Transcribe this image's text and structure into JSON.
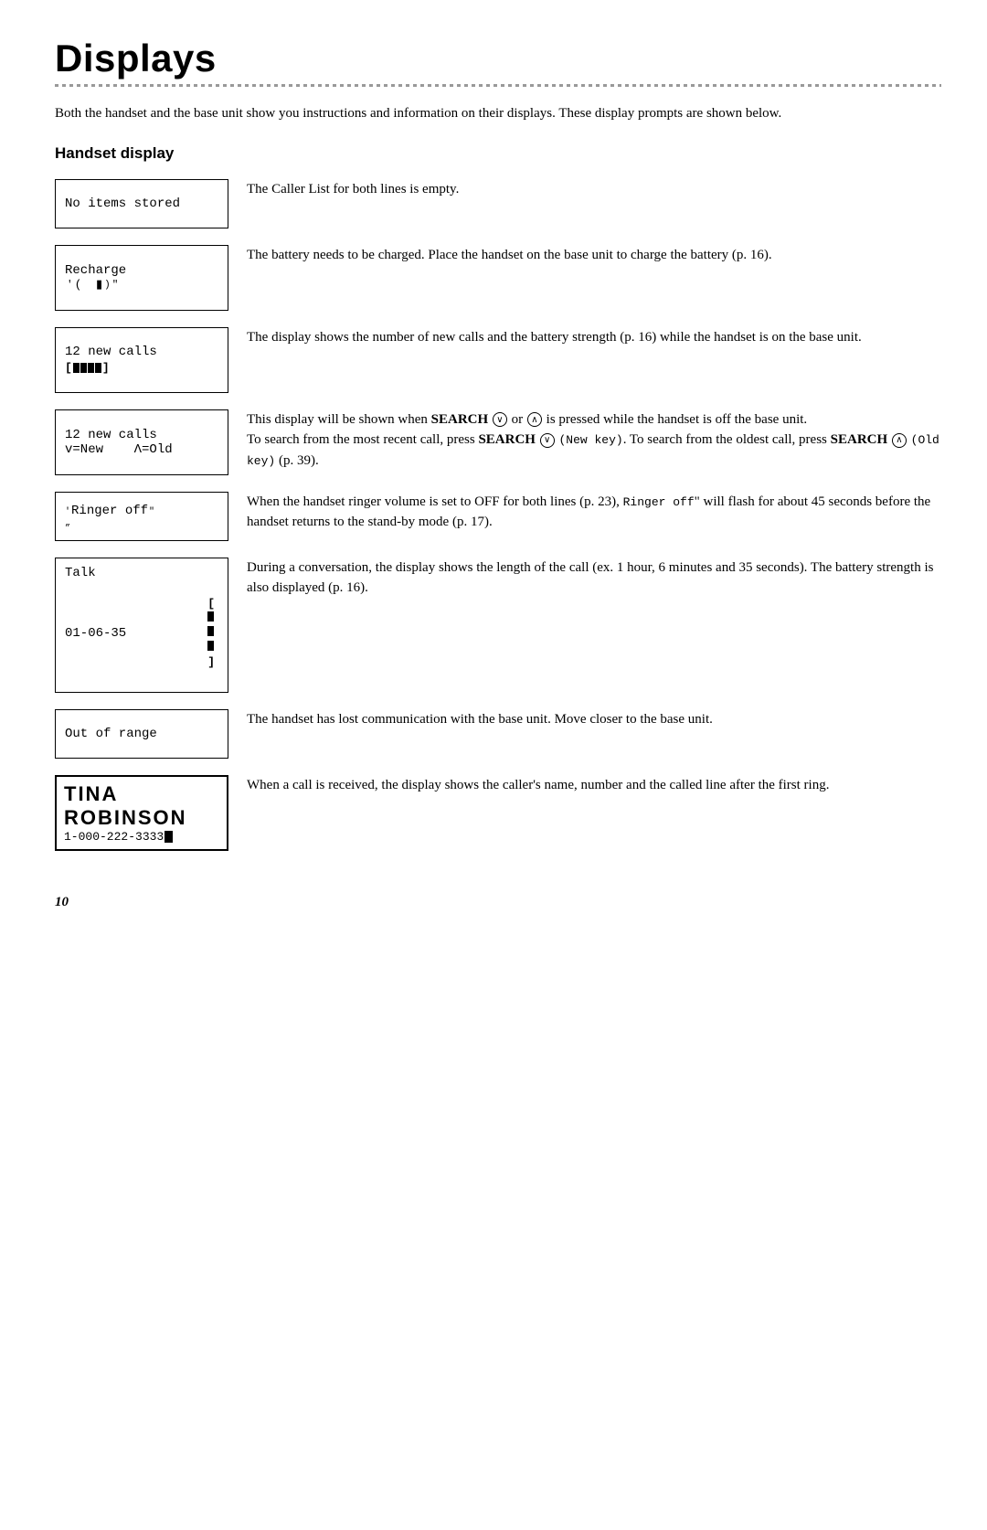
{
  "page": {
    "title": "Displays",
    "intro": "Both the handset and the base unit show you instructions and information on their displays. These display prompts are shown below.",
    "section_title": "Handset display",
    "footer_page": "10"
  },
  "rows": [
    {
      "id": "no-items",
      "display_lines": [
        "No items stored"
      ],
      "description": "The Caller List for both lines is empty."
    },
    {
      "id": "recharge",
      "display_lines": [
        "Recharge",
        "recharge_icon"
      ],
      "description": "The battery needs to be charged. Place the handset on the base unit to charge the battery (p. 16)."
    },
    {
      "id": "new-calls-base",
      "display_lines": [
        "12 new calls",
        "battery_bar"
      ],
      "description": "The display shows the number of new calls and the battery strength (p. 16) while the handset is on the base unit."
    },
    {
      "id": "new-calls-search",
      "display_lines": [
        "12 new calls",
        "v=New   Λ=Old"
      ],
      "description_parts": [
        {
          "type": "text",
          "content": "This display will be shown when "
        },
        {
          "type": "bold",
          "content": "SEARCH"
        },
        {
          "type": "text",
          "content": " "
        },
        {
          "type": "circle_down",
          "content": "∨"
        },
        {
          "type": "text",
          "content": " or "
        },
        {
          "type": "circle_up",
          "content": "∧"
        },
        {
          "type": "text",
          "content": " is pressed while the handset is off the base unit.\nTo search from the most recent call, press "
        },
        {
          "type": "bold",
          "content": "SEARCH"
        },
        {
          "type": "text",
          "content": " "
        },
        {
          "type": "circle_down2",
          "content": "∨"
        },
        {
          "type": "text",
          "content": " (New key). To search from the oldest call, press "
        },
        {
          "type": "bold",
          "content": "SEARCH"
        },
        {
          "type": "text",
          "content": " "
        },
        {
          "type": "circle_up2",
          "content": "∧"
        },
        {
          "type": "text",
          "content": " (Old key) (p. 39)."
        }
      ]
    },
    {
      "id": "ringer-off",
      "display_lines": [
        "ringer_off"
      ],
      "description": "When the handset ringer volume is set to OFF for both lines (p. 23), \"Ringer off\" will flash for about 45 seconds before the handset returns to the stand-by mode (p. 17)."
    },
    {
      "id": "talk",
      "display_lines": [
        "Talk",
        "01-06-35  battery_bar2"
      ],
      "description": "During a conversation, the display shows the length of the call (ex. 1 hour, 6 minutes and 35 seconds). The battery strength is also displayed (p. 16)."
    },
    {
      "id": "out-of-range",
      "display_lines": [
        "Out of range"
      ],
      "description": "The handset has lost communication with the base unit. Move closer to the base unit."
    },
    {
      "id": "caller-id",
      "display_lines": [
        "caller_name",
        "1-000-222-3333"
      ],
      "description": "When a call is received, the display shows the caller's name, number and the called line after the first ring."
    }
  ]
}
